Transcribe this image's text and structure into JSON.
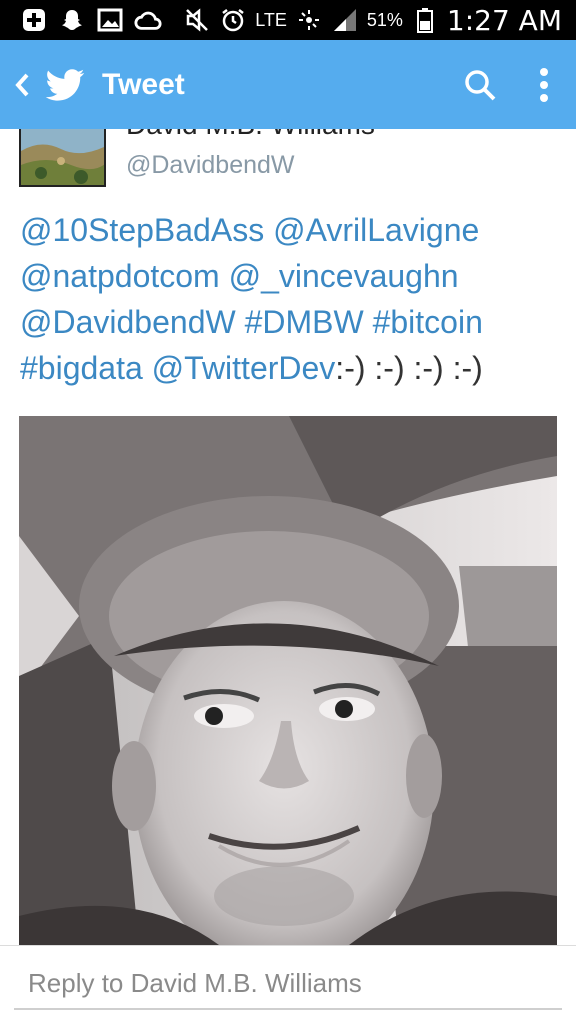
{
  "statusbar": {
    "network": "LTE",
    "battery": "51%",
    "time": "1:27 AM",
    "icons": [
      "plus-box-icon",
      "snapchat-icon",
      "image-icon",
      "cloud-icon",
      "mute-icon",
      "alarm-icon",
      "data-activity-icon",
      "signal-icon",
      "battery-icon"
    ]
  },
  "actionbar": {
    "title": "Tweet",
    "color": "#55acee",
    "icons": [
      "back-chevron-icon",
      "twitter-bird-icon",
      "search-icon",
      "overflow-menu-icon"
    ]
  },
  "tweet": {
    "display_name": "David M.B. Williams",
    "handle": "@DavidbendW",
    "text_parts": [
      {
        "text": "@10StepBadAss",
        "link": true
      },
      {
        "text": " ",
        "link": false
      },
      {
        "text": "@AvrilLavigne",
        "link": true
      },
      {
        "text": " ",
        "link": false
      },
      {
        "text": "@natpdotcom",
        "link": true
      },
      {
        "text": " ",
        "link": false
      },
      {
        "text": "@_vincevaughn",
        "link": true
      },
      {
        "text": " ",
        "link": false
      },
      {
        "text": "@DavidbendW",
        "link": true
      },
      {
        "text": "  ",
        "link": false
      },
      {
        "text": "#DMBW",
        "link": true
      },
      {
        "text": " ",
        "link": false
      },
      {
        "text": "#bitcoin",
        "link": true
      },
      {
        "text": " ",
        "link": false
      },
      {
        "text": "#bigdata",
        "link": true
      },
      {
        "text": " ",
        "link": false
      },
      {
        "text": "@TwitterDev",
        "link": true
      },
      {
        "text": ":-) :-) :-) :-)",
        "link": false
      }
    ],
    "link_color": "#3b88c3"
  },
  "reply": {
    "placeholder": "Reply to David M.B. Williams"
  }
}
